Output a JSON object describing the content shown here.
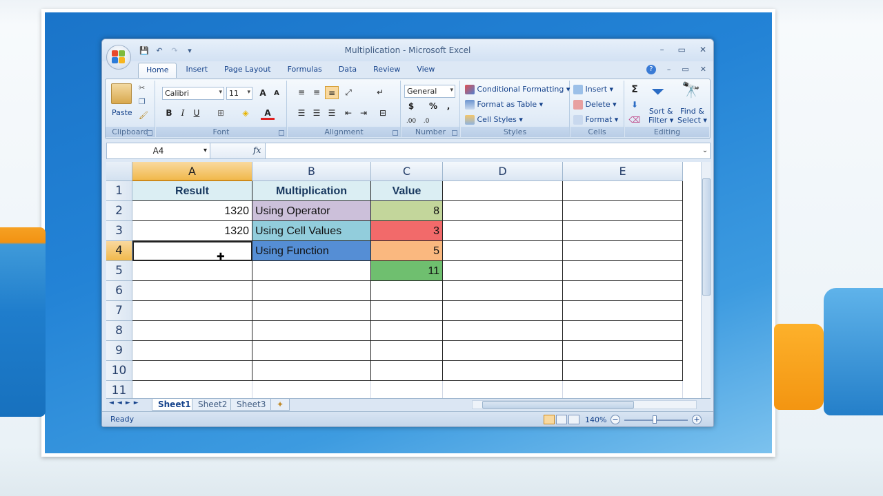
{
  "window": {
    "title": "Multiplication - Microsoft Excel",
    "minimize": "–",
    "maximize": "▭",
    "close": "✕"
  },
  "qat": {
    "save": "💾",
    "undo": "↶",
    "redo": "↷",
    "customize": "▾"
  },
  "tabs": [
    "Home",
    "Insert",
    "Page Layout",
    "Formulas",
    "Data",
    "Review",
    "View"
  ],
  "active_tab": "Home",
  "ribbon": {
    "clipboard": {
      "label": "Clipboard",
      "paste": "Paste"
    },
    "font": {
      "label": "Font",
      "font_name": "Calibri",
      "font_size": "11",
      "bold": "B",
      "italic": "I",
      "underline": "U"
    },
    "alignment": {
      "label": "Alignment"
    },
    "number": {
      "label": "Number",
      "format": "General",
      "currency": "$",
      "percent": "%",
      "comma": ","
    },
    "styles": {
      "label": "Styles",
      "conditional": "Conditional Formatting",
      "format_table": "Format as Table",
      "cell_styles": "Cell Styles"
    },
    "cells": {
      "label": "Cells",
      "insert": "Insert",
      "delete": "Delete",
      "format": "Format"
    },
    "editing": {
      "label": "Editing",
      "sum": "Σ",
      "sort_filter_1": "Sort &",
      "sort_filter_2": "Filter",
      "find_select_1": "Find &",
      "find_select_2": "Select"
    }
  },
  "formula_bar": {
    "name_box": "A4",
    "fx": "fx",
    "formula": ""
  },
  "columns": [
    "A",
    "B",
    "C",
    "D",
    "E"
  ],
  "rows": [
    "1",
    "2",
    "3",
    "4",
    "5",
    "6",
    "7",
    "8",
    "9",
    "10",
    "11"
  ],
  "selected": {
    "column": "A",
    "row": "4"
  },
  "cells": {
    "A1": "Result",
    "B1": "Multiplication",
    "C1": "Value",
    "A2": "1320",
    "B2": "Using Operator",
    "C2": "8",
    "A3": "1320",
    "B3": "Using Cell Values",
    "C3": "3",
    "A4": "",
    "B4": "Using Function",
    "C4": "5",
    "C5": "11"
  },
  "colors": {
    "header_fill": "#dbeef3",
    "b2": "#ccc0da",
    "b3": "#92cddc",
    "b4": "#558ed5",
    "c2": "#c3d69b",
    "c3": "#f26a6a",
    "c4": "#fab87f",
    "c5": "#6fbf6f"
  },
  "sheet_tabs": [
    "Sheet1",
    "Sheet2",
    "Sheet3"
  ],
  "active_sheet": "Sheet1",
  "status": {
    "text": "Ready",
    "zoom": "140%"
  }
}
